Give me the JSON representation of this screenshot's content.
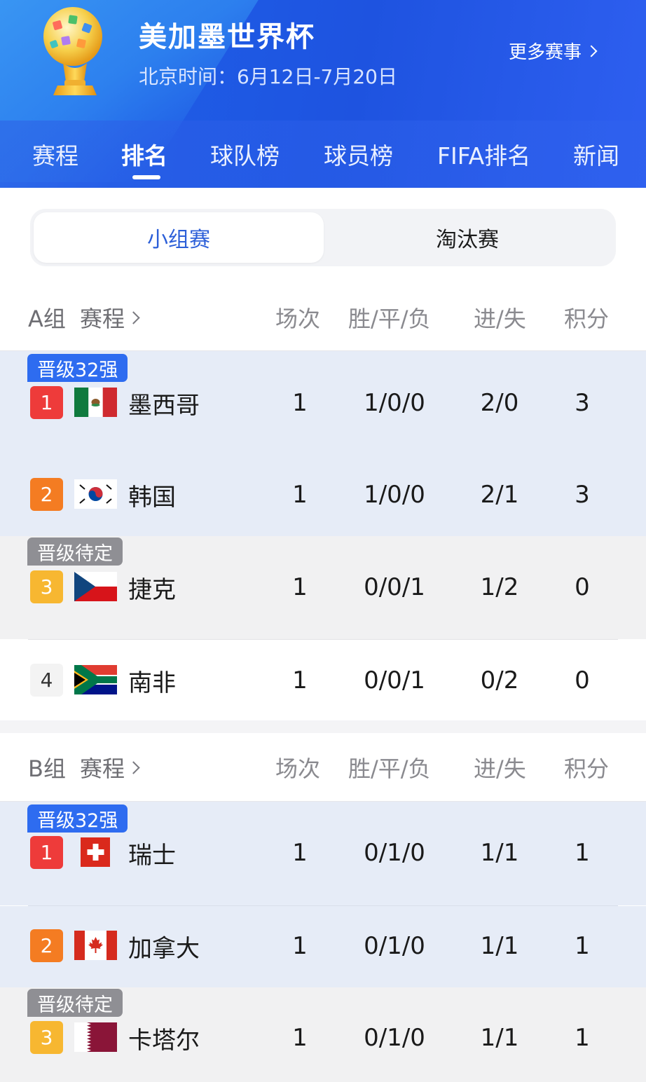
{
  "header": {
    "title": "美加墨世界杯",
    "subtitle": "北京时间：6月12日-7月20日",
    "more_label": "更多赛事"
  },
  "nav": {
    "tabs": [
      "赛程",
      "排名",
      "球队榜",
      "球员榜",
      "FIFA排名",
      "新闻"
    ],
    "active": "排名"
  },
  "segment": {
    "left": "小组赛",
    "right": "淘汰赛",
    "active": "小组赛"
  },
  "columns": {
    "played": "场次",
    "wdl": "胜/平/负",
    "goals": "进/失",
    "points": "积分"
  },
  "groups": [
    {
      "name": "A组",
      "schedule_link": "赛程",
      "badges": {
        "qualified": "晋级32强",
        "pending": "晋级待定"
      },
      "rows": [
        {
          "rank": "1",
          "team": "墨西哥",
          "flag": "mexico-flag",
          "played": "1",
          "wdl": "1/0/0",
          "goals": "2/0",
          "points": "3"
        },
        {
          "rank": "2",
          "team": "韩国",
          "flag": "south-korea-flag",
          "played": "1",
          "wdl": "1/0/0",
          "goals": "2/1",
          "points": "3"
        },
        {
          "rank": "3",
          "team": "捷克",
          "flag": "czech-flag",
          "played": "1",
          "wdl": "0/0/1",
          "goals": "1/2",
          "points": "0"
        },
        {
          "rank": "4",
          "team": "南非",
          "flag": "south-africa-flag",
          "played": "1",
          "wdl": "0/0/1",
          "goals": "0/2",
          "points": "0"
        }
      ]
    },
    {
      "name": "B组",
      "schedule_link": "赛程",
      "badges": {
        "qualified": "晋级32强",
        "pending": "晋级待定"
      },
      "rows": [
        {
          "rank": "1",
          "team": "瑞士",
          "flag": "switzerland-flag",
          "played": "1",
          "wdl": "0/1/0",
          "goals": "1/1",
          "points": "1"
        },
        {
          "rank": "2",
          "team": "加拿大",
          "flag": "canada-flag",
          "played": "1",
          "wdl": "0/1/0",
          "goals": "1/1",
          "points": "1"
        },
        {
          "rank": "3",
          "team": "卡塔尔",
          "flag": "qatar-flag",
          "played": "1",
          "wdl": "0/1/0",
          "goals": "1/1",
          "points": "1"
        }
      ]
    }
  ],
  "colors": {
    "header_blue": "#1e53e0",
    "accent_blue": "#2e6cf0",
    "rank1": "#ee3b3a",
    "rank2": "#f47c22",
    "rank3": "#f7b731",
    "qualified_row": "#e6ecf7",
    "pending_row": "#f1f1f2"
  }
}
